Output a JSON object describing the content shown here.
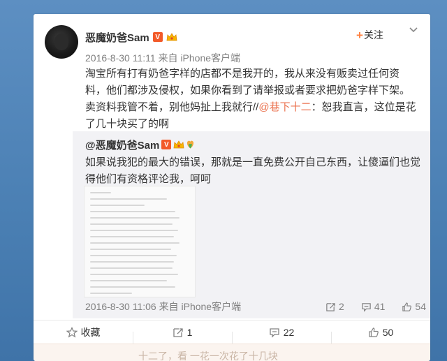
{
  "post": {
    "author": "恶魔奶爸Sam",
    "vip_label": "V",
    "follow_label": "关注",
    "meta": "2016-8-30 11:11 来自 iPhone客户端",
    "text_main": "淘宝所有打有奶爸字样的店都不是我开的，我从来没有贩卖过任何资料，他们都涉及侵权，如果你看到了请举报或者要求把奶爸字样下架。卖资料我管不着，别他妈扯上我就行//",
    "mention": "@巷下十二",
    "text_after_mention": "：恕我直言，这位是花了几十块买了的啊"
  },
  "repost": {
    "author": "@恶魔奶爸Sam",
    "vip_label": "V",
    "text": "如果说我犯的最大的错误，那就是一直免费公开自己东西，让傻逼们也觉得他们有资格评论我，呵呵",
    "meta": "2016-8-30 11:06 来自 iPhone客户端",
    "reposts": "2",
    "comments": "41",
    "likes": "54"
  },
  "actions": {
    "favorite": "收藏",
    "repost": "1",
    "comment": "22",
    "like": "50"
  },
  "next_strip": "十二了，看 一花一次花了十几块",
  "colors": {
    "background": "#4a7fb3",
    "accent": "#eb7350",
    "follow_plus": "#ff8140",
    "vip": "#f25a29"
  },
  "icons": [
    "crown-icon",
    "chevron-down-icon",
    "repost-icon",
    "comment-icon",
    "like-icon",
    "star-icon"
  ]
}
